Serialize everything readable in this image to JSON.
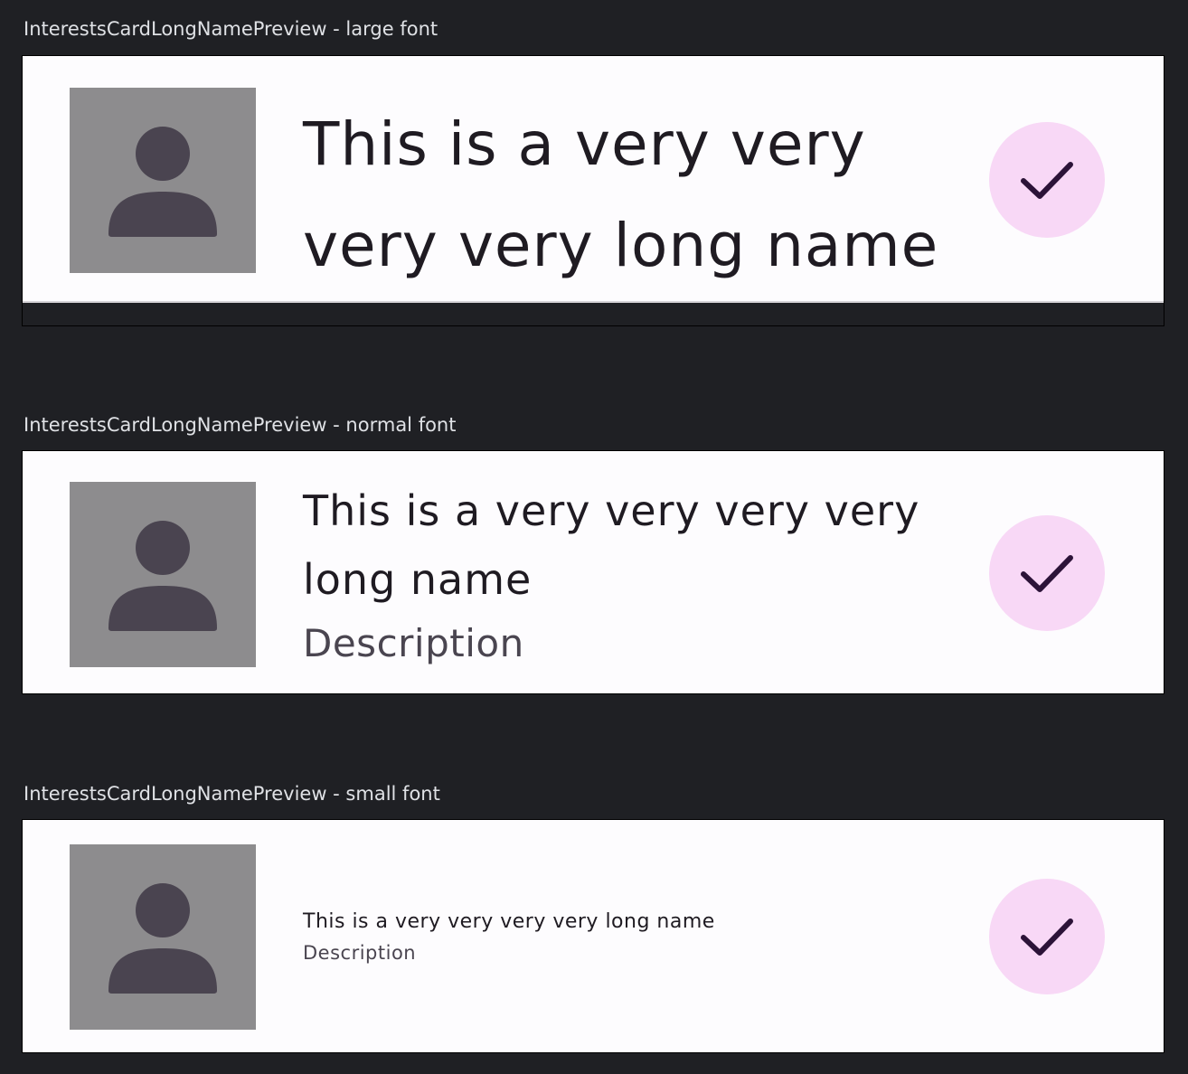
{
  "previews": [
    {
      "title": "InterestsCardLongNamePreview - large font",
      "card": {
        "name": "This is a very very very very long name",
        "description": "",
        "icon": "person-icon",
        "toggle_icon": "check-icon"
      }
    },
    {
      "title": "InterestsCardLongNamePreview - normal font",
      "card": {
        "name": "This is a very very very very long name",
        "description": "Description",
        "icon": "person-icon",
        "toggle_icon": "check-icon"
      }
    },
    {
      "title": "InterestsCardLongNamePreview - small font",
      "card": {
        "name": "This is a very very very very long name",
        "description": "Description",
        "icon": "person-icon",
        "toggle_icon": "check-icon"
      }
    }
  ],
  "colors": {
    "background": "#1f2024",
    "card": "#fdfcfe",
    "avatar_bg": "#8d8c8e",
    "avatar_figure": "#4a4450",
    "check_bg": "#f8d8f6",
    "check_mark": "#2c1338"
  }
}
